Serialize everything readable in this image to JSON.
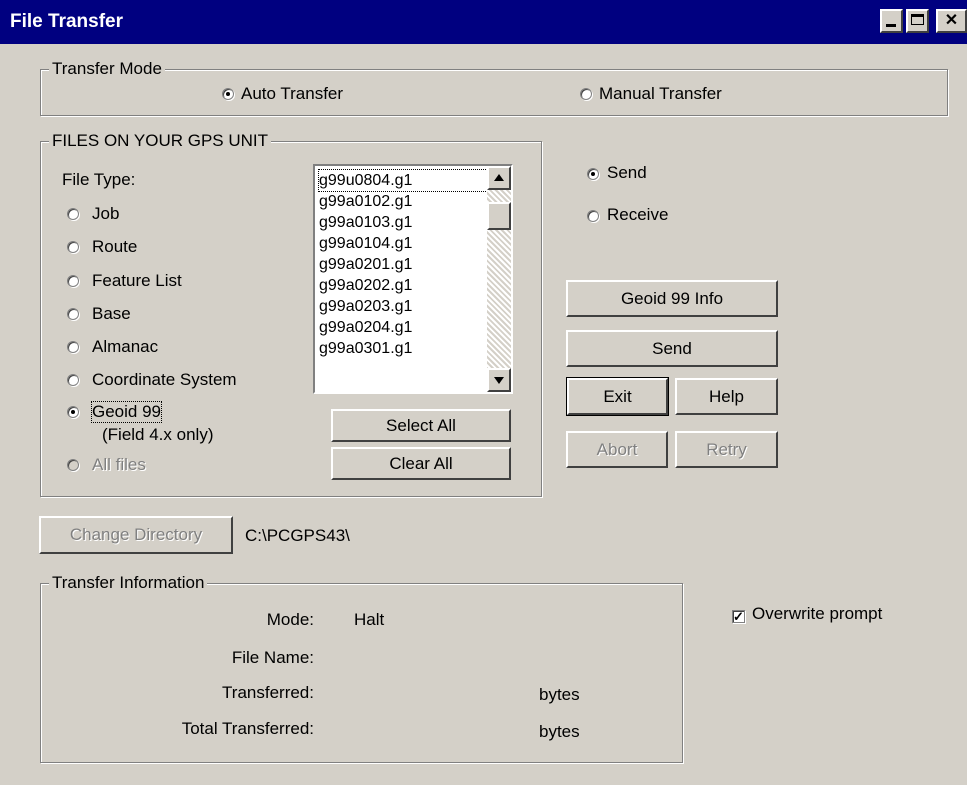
{
  "window": {
    "title": "File Transfer"
  },
  "transfer_mode": {
    "label": "Transfer Mode",
    "options": [
      {
        "label": "Auto Transfer",
        "checked": true
      },
      {
        "label": "Manual Transfer",
        "checked": false
      }
    ]
  },
  "files_group": {
    "label": "FILES ON YOUR GPS UNIT",
    "file_type_label": "File Type:",
    "file_types": [
      {
        "label": "Job",
        "checked": false,
        "enabled": true
      },
      {
        "label": "Route",
        "checked": false,
        "enabled": true
      },
      {
        "label": "Feature List",
        "checked": false,
        "enabled": true
      },
      {
        "label": "Base",
        "checked": false,
        "enabled": true
      },
      {
        "label": "Almanac",
        "checked": false,
        "enabled": true
      },
      {
        "label": "Coordinate System",
        "checked": false,
        "enabled": true
      },
      {
        "label": "Geoid 99",
        "checked": true,
        "enabled": true
      },
      {
        "label": "All files",
        "checked": false,
        "enabled": false
      }
    ],
    "geoid_note": "(Field 4.x only)",
    "files": [
      "g99u0804.g1",
      "g99a0102.g1",
      "g99a0103.g1",
      "g99a0104.g1",
      "g99a0201.g1",
      "g99a0202.g1",
      "g99a0203.g1",
      "g99a0204.g1",
      "g99a0301.g1"
    ],
    "select_all_label": "Select All",
    "clear_all_label": "Clear All"
  },
  "direction": {
    "options": [
      {
        "label": "Send",
        "checked": true
      },
      {
        "label": "Receive",
        "checked": false
      }
    ]
  },
  "actions": {
    "geoid_info_label": "Geoid 99 Info",
    "send_label": "Send",
    "exit_label": "Exit",
    "help_label": "Help",
    "abort_label": "Abort",
    "retry_label": "Retry"
  },
  "directory": {
    "change_label": "Change Directory",
    "path": "C:\\PCGPS43\\"
  },
  "transfer_info": {
    "label": "Transfer Information",
    "mode_label": "Mode:",
    "mode_value": "Halt",
    "file_name_label": "File Name:",
    "transferred_label": "Transferred:",
    "transferred_unit": "bytes",
    "total_label": "Total Transferred:",
    "total_unit": "bytes"
  },
  "overwrite": {
    "label": "Overwrite prompt",
    "checked": true
  }
}
